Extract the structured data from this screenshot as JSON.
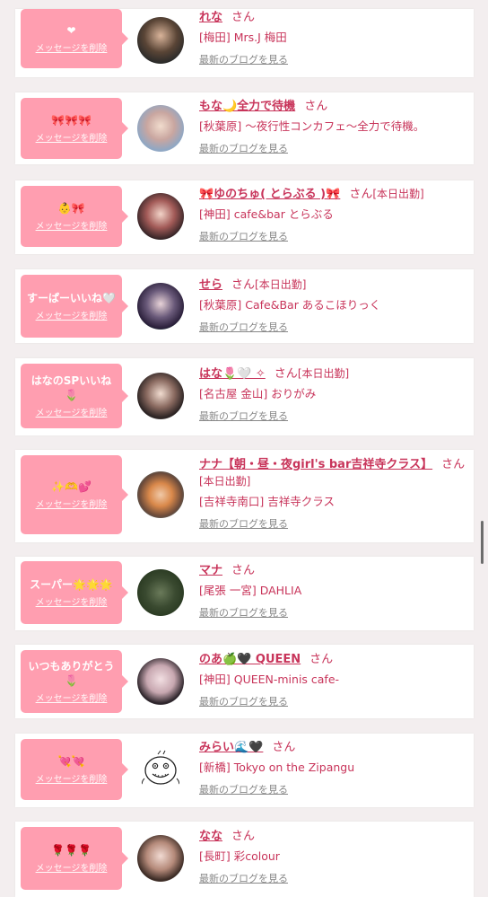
{
  "delete_label": "メッセージを削除",
  "blog_label": "最新のブログを見る",
  "san_label": "さん",
  "cards": [
    {
      "msg": "❤",
      "name": "れな",
      "status": "",
      "shop": "[梅田] Mrs.J 梅田"
    },
    {
      "msg": "🎀🎀🎀",
      "name": "もな🌙全力で待機",
      "status": "",
      "shop": "[秋葉原] 〜夜行性コンカフェ〜全力で待機。"
    },
    {
      "msg": "👶🎀",
      "name": "🎀ゆのちゅ( とらぶる )🎀",
      "status": "[本日出勤]",
      "shop": "[神田] cafe&bar とらぶる"
    },
    {
      "msg": "すーぱーいいね🤍",
      "name": "せら",
      "status": "[本日出勤]",
      "shop": "[秋葉原] Cafe&Bar あるこほりっく"
    },
    {
      "msg": "はなのSPいいね🌷",
      "name": "はな🌷🤍 ✧",
      "status": "[本日出勤]",
      "shop": "[名古屋 金山] おりがみ"
    },
    {
      "msg": "✨🫶💕",
      "name": "ナナ【朝・昼・夜girl's bar吉祥寺クラス】",
      "status": "[本日出勤]",
      "shop": "[吉祥寺南口] 吉祥寺クラス"
    },
    {
      "msg": "スーパー🌟🌟🌟",
      "name": "マナ",
      "status": "",
      "shop": "[尾張 一宮] DAHLIA"
    },
    {
      "msg": "いつもありがとう🌷",
      "name": "のあ🍏🖤 QUEEN",
      "status": "",
      "shop": "[神田] QUEEN-minis cafe-"
    },
    {
      "msg": "💘💘",
      "name": "みらい🌊🖤",
      "status": "",
      "shop": "[新橋] Tokyo on the Zipangu"
    },
    {
      "msg": "🌹🌹🌹",
      "name": "なな",
      "status": "",
      "shop": "[長町] 彩colour"
    }
  ]
}
